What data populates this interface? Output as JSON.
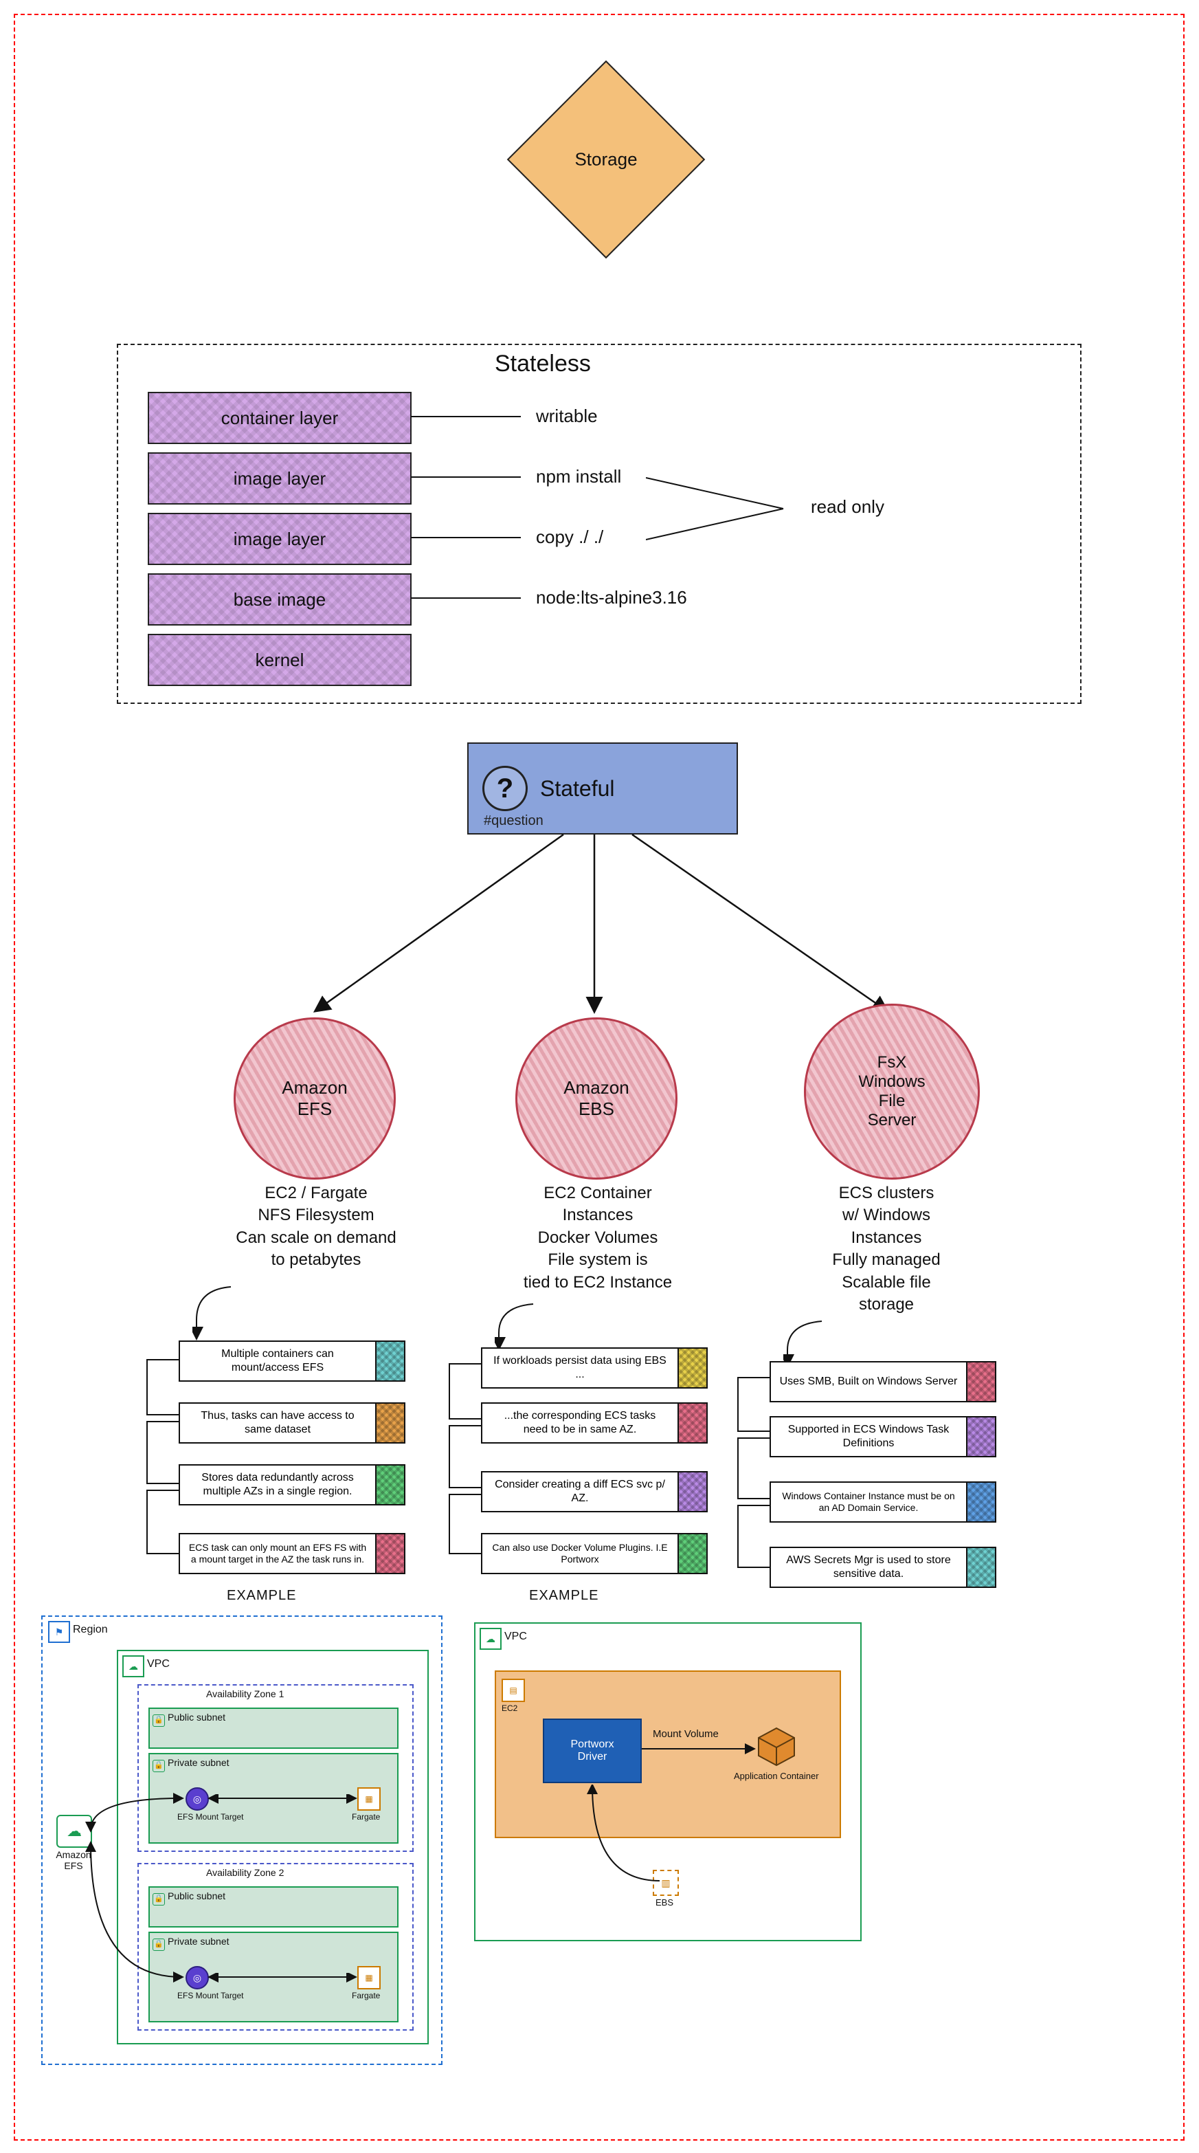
{
  "storage": {
    "label": "Storage"
  },
  "stateless": {
    "title": "Stateless",
    "layers": [
      {
        "name": "container layer",
        "annot": "writable"
      },
      {
        "name": "image layer",
        "annot": "npm install"
      },
      {
        "name": "image layer",
        "annot": "copy ./ ./"
      },
      {
        "name": "base image",
        "annot": "node:lts-alpine3.16"
      },
      {
        "name": "kernel",
        "annot": ""
      }
    ],
    "read_only_label": "read only"
  },
  "stateful": {
    "title": "Stateful",
    "tag": "#question"
  },
  "options": {
    "efs": {
      "title": "Amazon\nEFS",
      "desc": "EC2 / Fargate\nNFS Filesystem\nCan scale on demand\nto petabytes",
      "notes": [
        {
          "text": "Multiple containers can mount/access EFS",
          "swatch": "#6fd1d1"
        },
        {
          "text": "Thus, tasks can have access to same dataset",
          "swatch": "#e8a24a"
        },
        {
          "text": "Stores data redundantly across multiple AZs in a single region.",
          "swatch": "#5fcf7a"
        },
        {
          "text": "ECS task can only mount an EFS FS with a mount target in the AZ the task runs in.",
          "swatch": "#e86f8a"
        }
      ],
      "example_label": "EXAMPLE"
    },
    "ebs": {
      "title": "Amazon\nEBS",
      "desc": "EC2 Container\nInstances\nDocker Volumes\nFile system is\ntied to EC2 Instance",
      "notes": [
        {
          "text": "If workloads persist data using EBS ...",
          "swatch": "#e8d14a"
        },
        {
          "text": "...the corresponding ECS tasks need to be in same AZ.",
          "swatch": "#e86f8a"
        },
        {
          "text": "Consider creating a diff ECS svc p/ AZ.",
          "swatch": "#b98ae6"
        },
        {
          "text": "Can also use Docker Volume Plugins. I.E Portworx",
          "swatch": "#5fcf7a"
        }
      ],
      "example_label": "EXAMPLE"
    },
    "fsx": {
      "title": "FsX\nWindows\nFile\nServer",
      "desc": "ECS clusters\nw/ Windows\nInstances\nFully managed\nScalable file\nstorage",
      "notes": [
        {
          "text": "Uses SMB, Built on Windows Server",
          "swatch": "#e86f8a"
        },
        {
          "text": "Supported in ECS Windows Task Definitions",
          "swatch": "#b98ae6"
        },
        {
          "text": "Windows Container Instance must be on an AD Domain Service.",
          "swatch": "#5fa1e6"
        },
        {
          "text": "AWS Secrets Mgr is used to store sensitive data.",
          "swatch": "#6fd1d1"
        }
      ]
    }
  },
  "efs_arch": {
    "region": "Region",
    "vpc": "VPC",
    "az1": "Availability Zone 1",
    "az2": "Availability Zone 2",
    "public_subnet": "Public subnet",
    "private_subnet": "Private subnet",
    "mount_target": "EFS Mount Target",
    "fargate": "Fargate",
    "efs": "Amazon\nEFS"
  },
  "ebs_arch": {
    "vpc": "VPC",
    "ec2": "EC2",
    "portworx": "Portworx\nDriver",
    "mount_volume": "Mount Volume",
    "app_container": "Application Container",
    "ebs": "EBS"
  }
}
